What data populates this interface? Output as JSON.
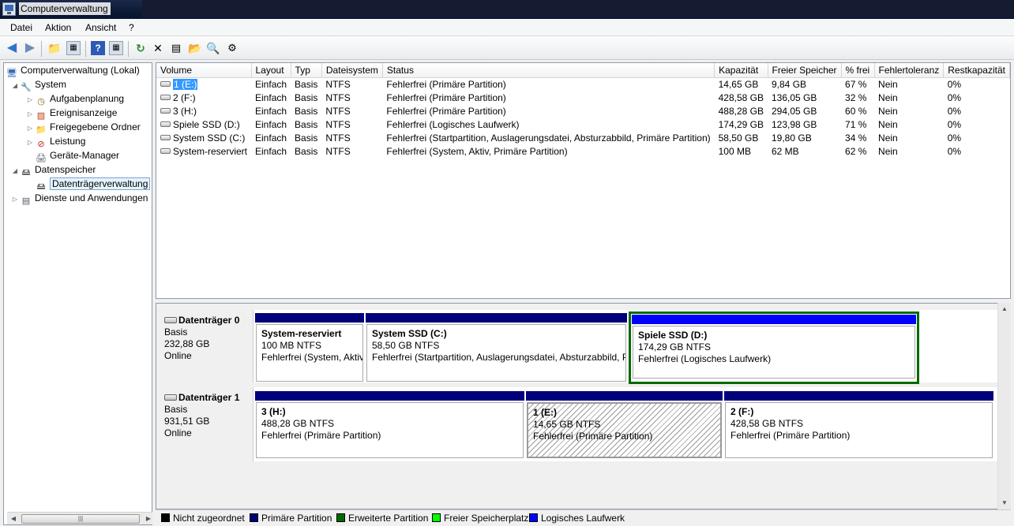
{
  "window": {
    "title": "Computerverwaltung"
  },
  "menu": {
    "items": [
      "Datei",
      "Aktion",
      "Ansicht",
      "?"
    ]
  },
  "toolbar": {
    "icons": [
      "back-arrow-icon",
      "forward-arrow-icon",
      "up-folder-icon",
      "show-hide-tree-icon",
      "help-icon",
      "properties-pane-icon",
      "refresh-icon",
      "delete-icon",
      "properties-icon",
      "open-folder-icon",
      "search-icon",
      "settings-icon"
    ]
  },
  "tree": {
    "root": "Computerverwaltung (Lokal)",
    "system": "System",
    "aufgabenplanung": "Aufgabenplanung",
    "ereignisanzeige": "Ereignisanzeige",
    "freigegebene_ordner": "Freigegebene Ordner",
    "leistung": "Leistung",
    "geraete_manager": "Geräte-Manager",
    "datenspeicher": "Datenspeicher",
    "datentraegerverwaltung": "Datenträgerverwaltung",
    "dienste": "Dienste und Anwendungen"
  },
  "volumes": {
    "columns": [
      "Volume",
      "Layout",
      "Typ",
      "Dateisystem",
      "Status",
      "Kapazität",
      "Freier Speicher",
      "% frei",
      "Fehlertoleranz",
      "Restkapazität"
    ],
    "rows": [
      {
        "volume": "1 (E:)",
        "layout": "Einfach",
        "typ": "Basis",
        "fs": "NTFS",
        "status": "Fehlerfrei (Primäre Partition)",
        "kap": "14,65 GB",
        "frei": "9,84 GB",
        "pct": "67 %",
        "ft": "Nein",
        "rest": "0%"
      },
      {
        "volume": "2 (F:)",
        "layout": "Einfach",
        "typ": "Basis",
        "fs": "NTFS",
        "status": "Fehlerfrei (Primäre Partition)",
        "kap": "428,58 GB",
        "frei": "136,05 GB",
        "pct": "32 %",
        "ft": "Nein",
        "rest": "0%"
      },
      {
        "volume": "3 (H:)",
        "layout": "Einfach",
        "typ": "Basis",
        "fs": "NTFS",
        "status": "Fehlerfrei (Primäre Partition)",
        "kap": "488,28 GB",
        "frei": "294,05 GB",
        "pct": "60 %",
        "ft": "Nein",
        "rest": "0%"
      },
      {
        "volume": "Spiele SSD (D:)",
        "layout": "Einfach",
        "typ": "Basis",
        "fs": "NTFS",
        "status": "Fehlerfrei (Logisches Laufwerk)",
        "kap": "174,29 GB",
        "frei": "123,98 GB",
        "pct": "71 %",
        "ft": "Nein",
        "rest": "0%"
      },
      {
        "volume": "System SSD (C:)",
        "layout": "Einfach",
        "typ": "Basis",
        "fs": "NTFS",
        "status": "Fehlerfrei (Startpartition, Auslagerungsdatei, Absturzabbild, Primäre Partition)",
        "kap": "58,50 GB",
        "frei": "19,80 GB",
        "pct": "34 %",
        "ft": "Nein",
        "rest": "0%"
      },
      {
        "volume": "System-reserviert",
        "layout": "Einfach",
        "typ": "Basis",
        "fs": "NTFS",
        "status": "Fehlerfrei (System, Aktiv, Primäre Partition)",
        "kap": "100 MB",
        "frei": "62 MB",
        "pct": "62 %",
        "ft": "Nein",
        "rest": "0%"
      }
    ]
  },
  "disks": [
    {
      "name": "Datenträger 0",
      "type": "Basis",
      "size": "232,88 GB",
      "state": "Online",
      "partitions": [
        {
          "name": "System-reserviert",
          "size": "100 MB NTFS",
          "status": "Fehlerfrei (System, Aktiv"
        },
        {
          "name": "System SSD  (C:)",
          "size": "58,50 GB NTFS",
          "status": "Fehlerfrei (Startpartition, Auslagerungsdatei, Absturzabbild, P"
        },
        {
          "name": "Spiele SSD  (D:)",
          "size": "174,29 GB NTFS",
          "status": "Fehlerfrei (Logisches Laufwerk)"
        }
      ]
    },
    {
      "name": "Datenträger 1",
      "type": "Basis",
      "size": "931,51 GB",
      "state": "Online",
      "partitions": [
        {
          "name": "3  (H:)",
          "size": "488,28 GB NTFS",
          "status": "Fehlerfrei (Primäre Partition)"
        },
        {
          "name": "1  (E:)",
          "size": "14,65 GB NTFS",
          "status": "Fehlerfrei (Primäre Partition)"
        },
        {
          "name": "2  (F:)",
          "size": "428,58 GB NTFS",
          "status": "Fehlerfrei (Primäre Partition)"
        }
      ]
    }
  ],
  "legend": [
    {
      "label": "Nicht zugeordnet",
      "color": "#000000"
    },
    {
      "label": "Primäre Partition",
      "color": "#00007b"
    },
    {
      "label": "Erweiterte Partition",
      "color": "#006a00"
    },
    {
      "label": "Freier Speicherplatz",
      "color": "#00ff00"
    },
    {
      "label": "Logisches Laufwerk",
      "color": "#0000ff"
    }
  ]
}
